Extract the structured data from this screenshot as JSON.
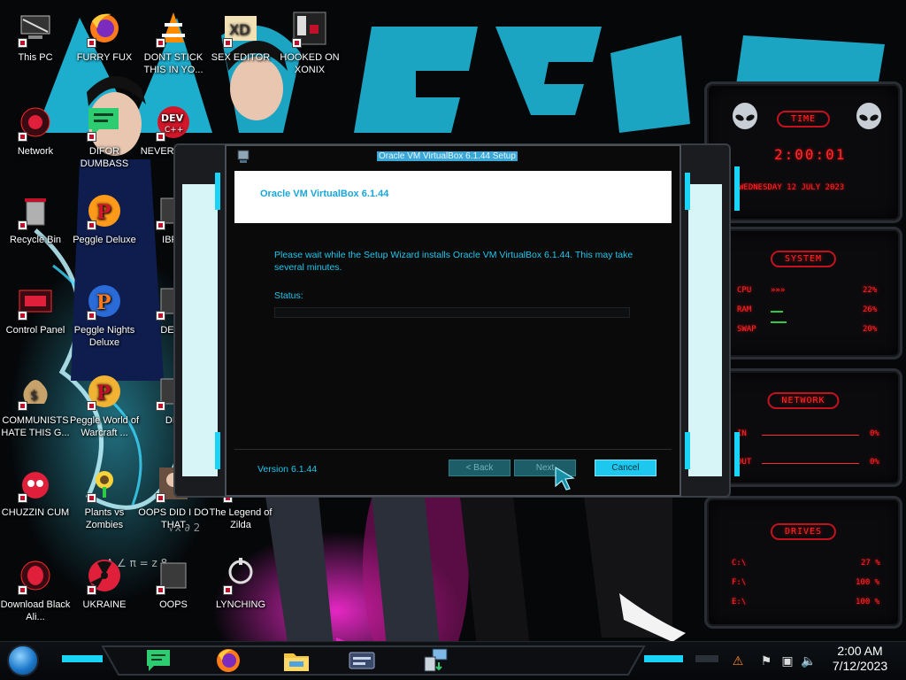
{
  "desktop": {
    "icons": [
      {
        "label": "This PC",
        "icon": "computer-icon"
      },
      {
        "label": "FURRY FUX",
        "icon": "firefox-icon"
      },
      {
        "label": "DONT STICK THIS IN YO...",
        "icon": "vlc-cone-icon"
      },
      {
        "label": "SEX EDITOR",
        "icon": "xd-editor-icon"
      },
      {
        "label": "HOOKED ON XONIX",
        "icon": "xonix-game-icon"
      },
      {
        "label": "Network",
        "icon": "network-icon"
      },
      {
        "label": "DIFOR DUMBASS",
        "icon": "message-bubble-icon"
      },
      {
        "label": "NEVER USED!",
        "icon": "dev-cpp-icon"
      },
      {
        "label": "Recycle Bin",
        "icon": "recycle-bin-icon"
      },
      {
        "label": "Peggle Deluxe",
        "icon": "peggle-icon"
      },
      {
        "label": "IBRA",
        "icon": "app-icon"
      },
      {
        "label": "Control Panel",
        "icon": "control-panel-icon"
      },
      {
        "label": "Peggle Nights Deluxe",
        "icon": "peggle-nights-icon"
      },
      {
        "label": "DEEZ",
        "icon": "app-icon"
      },
      {
        "label": "COMMUNISTS HATE THIS G...",
        "icon": "money-bag-icon"
      },
      {
        "label": "Peggle World of Warcraft ...",
        "icon": "peggle-wow-icon"
      },
      {
        "label": "DIE",
        "icon": "app-icon"
      },
      {
        "label": "CHUZZIN CUM",
        "icon": "chuzzle-icon"
      },
      {
        "label": "Plants vs Zombies",
        "icon": "pvz-icon"
      },
      {
        "label": "OOPS DID I DO THAT",
        "icon": "portrait-icon"
      },
      {
        "label": "The Legend of Zilda",
        "icon": "app-icon"
      },
      {
        "label": "Download Black Ali...",
        "icon": "alien-icon"
      },
      {
        "label": "UKRAINE",
        "icon": "radiation-icon"
      },
      {
        "label": "OOPS",
        "icon": "app-icon"
      },
      {
        "label": "LYNCHING",
        "icon": "lynching-icon"
      }
    ]
  },
  "widgets": {
    "time": {
      "title": "TIME",
      "clock": "2:00:01",
      "date": "WEDNESDAY 12 JULY 2023"
    },
    "system": {
      "title": "SYSTEM",
      "rows": [
        {
          "label": "CPU",
          "value": "22%"
        },
        {
          "label": "RAM",
          "value": "26%"
        },
        {
          "label": "SWAP",
          "value": "20%"
        }
      ]
    },
    "network": {
      "title": "NETWORK",
      "rows": [
        {
          "label": "IN",
          "value": "0%"
        },
        {
          "label": "OUT",
          "value": "0%"
        }
      ]
    },
    "drives": {
      "title": "DRIVES",
      "rows": [
        {
          "label": "C:\\",
          "value": "27 %"
        },
        {
          "label": "F:\\",
          "value": "100 %"
        },
        {
          "label": "E:\\",
          "value": "100 %"
        }
      ]
    }
  },
  "installer": {
    "window_title": "Oracle VM VirtualBox 6.1.44 Setup",
    "header_title": "Oracle VM VirtualBox 6.1.44",
    "body": "Please wait while the Setup Wizard installs Oracle VM VirtualBox 6.1.44. This may take several minutes.",
    "status_label": "Status:",
    "progress_percent": 0,
    "version": "Version 6.1.44",
    "back_label": "< Back",
    "next_label": "Next",
    "cancel_label": "Cancel"
  },
  "taskbar": {
    "apps": [
      "message-bubble-icon",
      "firefox-icon",
      "file-explorer-icon",
      "virtualbox-icon",
      "installer-icon"
    ],
    "clock_time": "2:00 AM",
    "clock_date": "7/12/2023"
  },
  "colors": {
    "accent_cyan": "#1ec7ee",
    "widget_red": "#ff2a2a",
    "header_blue": "#19a6d6"
  }
}
